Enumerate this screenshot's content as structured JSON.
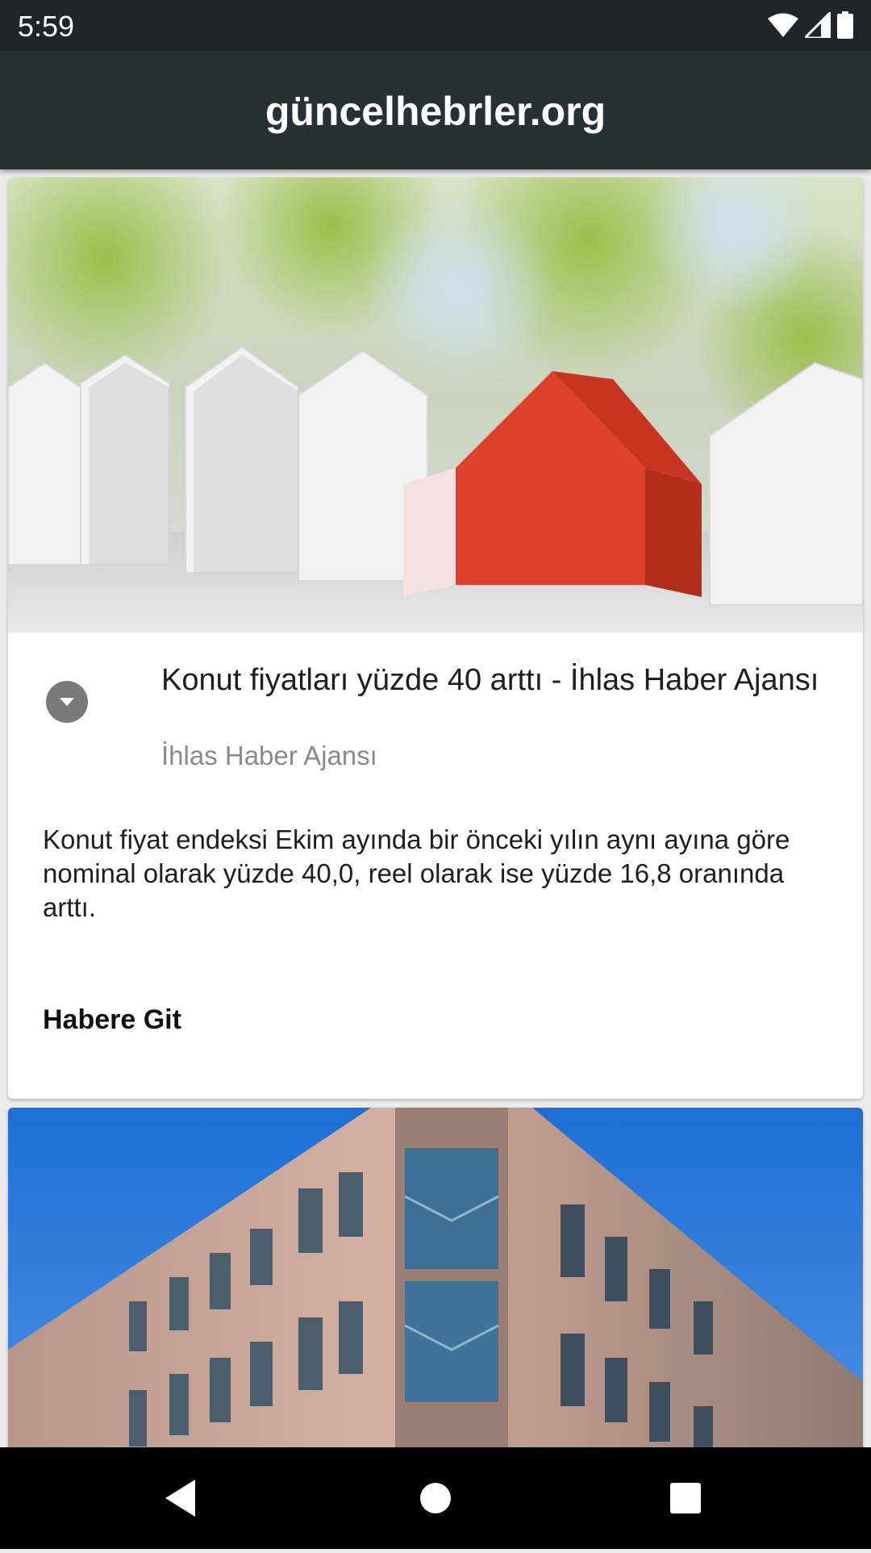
{
  "status_bar": {
    "time": "5:59",
    "icons": [
      "wifi-icon",
      "signal-icon",
      "battery-icon"
    ]
  },
  "app_bar": {
    "title": "güncelhebrler.org",
    "background": "#263035"
  },
  "feed": {
    "cards": [
      {
        "image": "houses-photo",
        "title": "Konut fiyatları yüzde 40 arttı - İhlas Haber Ajansı",
        "source": "İhlas Haber Ajansı",
        "description": "Konut fiyat endeksi Ekim ayında bir önceki yılın aynı ayına göre nominal olarak yüzde 40,0, reel olarak ise yüzde 16,8 oranında arttı.",
        "link_label": "Habere Git"
      },
      {
        "image": "building-photo"
      }
    ]
  },
  "nav_bar": {
    "buttons": [
      "back-icon",
      "home-icon",
      "recents-icon"
    ]
  }
}
